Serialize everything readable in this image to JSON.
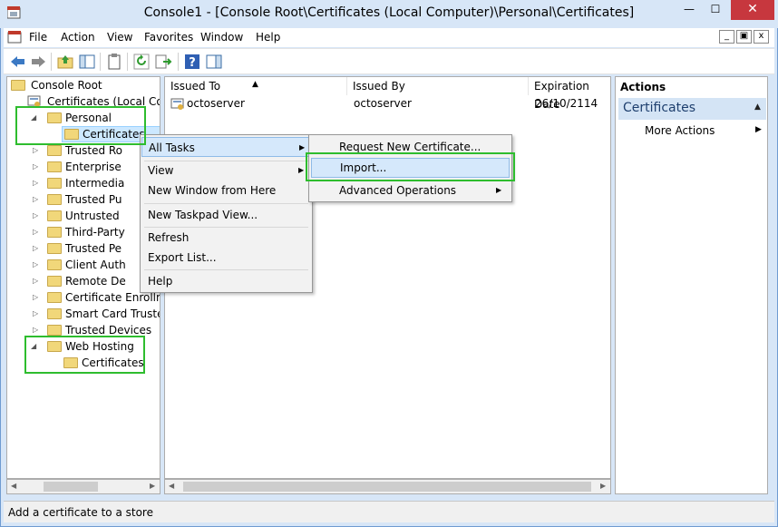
{
  "window": {
    "title": "Console1 - [Console Root\\Certificates (Local Computer)\\Personal\\Certificates]",
    "minimize_glyph": "—",
    "maximize_glyph": "☐",
    "close_glyph": "✕"
  },
  "menubar": {
    "items": [
      "File",
      "Action",
      "View",
      "Favorites",
      "Window",
      "Help"
    ],
    "mdi_min": "_",
    "mdi_restore": "▣",
    "mdi_close": "x"
  },
  "toolbar": {
    "icons": [
      "back-icon",
      "forward-icon",
      "up-folder-icon",
      "show-hide-tree-icon",
      "properties-icon",
      "refresh-icon",
      "export-list-icon",
      "help-icon",
      "action-pane-icon"
    ]
  },
  "tree": {
    "root": "Console Root",
    "certificates": "Certificates (Local Com",
    "personal": "Personal",
    "personal_certificates": "Certificates",
    "items": [
      "Trusted Ro",
      "Enterprise",
      "Intermedia",
      "Trusted Pu",
      "Untrusted",
      "Third-Party",
      "Trusted Pe",
      "Client Auth",
      "Remote De",
      "Certificate Enrollme",
      "Smart Card Trusted",
      "Trusted Devices"
    ],
    "web_hosting": "Web Hosting",
    "web_hosting_certificates": "Certificates"
  },
  "list": {
    "columns": [
      "Issued To",
      "Issued By",
      "Expiration Date"
    ],
    "rows": [
      {
        "issued_to": "octoserver",
        "issued_by": "octoserver",
        "expiration": "26/10/2114"
      }
    ]
  },
  "actions": {
    "title": "Actions",
    "section": "Certificates",
    "items": [
      "More Actions"
    ]
  },
  "context_menu": {
    "all_tasks": "All Tasks",
    "view": "View",
    "new_window": "New Window from Here",
    "new_taskpad": "New Taskpad View...",
    "refresh": "Refresh",
    "export_list": "Export List...",
    "help": "Help"
  },
  "submenu": {
    "request_new": "Request New Certificate...",
    "import": "Import...",
    "advanced": "Advanced Operations"
  },
  "status": {
    "text": "Add a certificate to a store"
  },
  "colors": {
    "frame": "#d7e6f7",
    "close": "#c7373e",
    "highlight_green": "#2ebd2e",
    "selection": "#cce8ff",
    "folder": "#f1d77a"
  }
}
